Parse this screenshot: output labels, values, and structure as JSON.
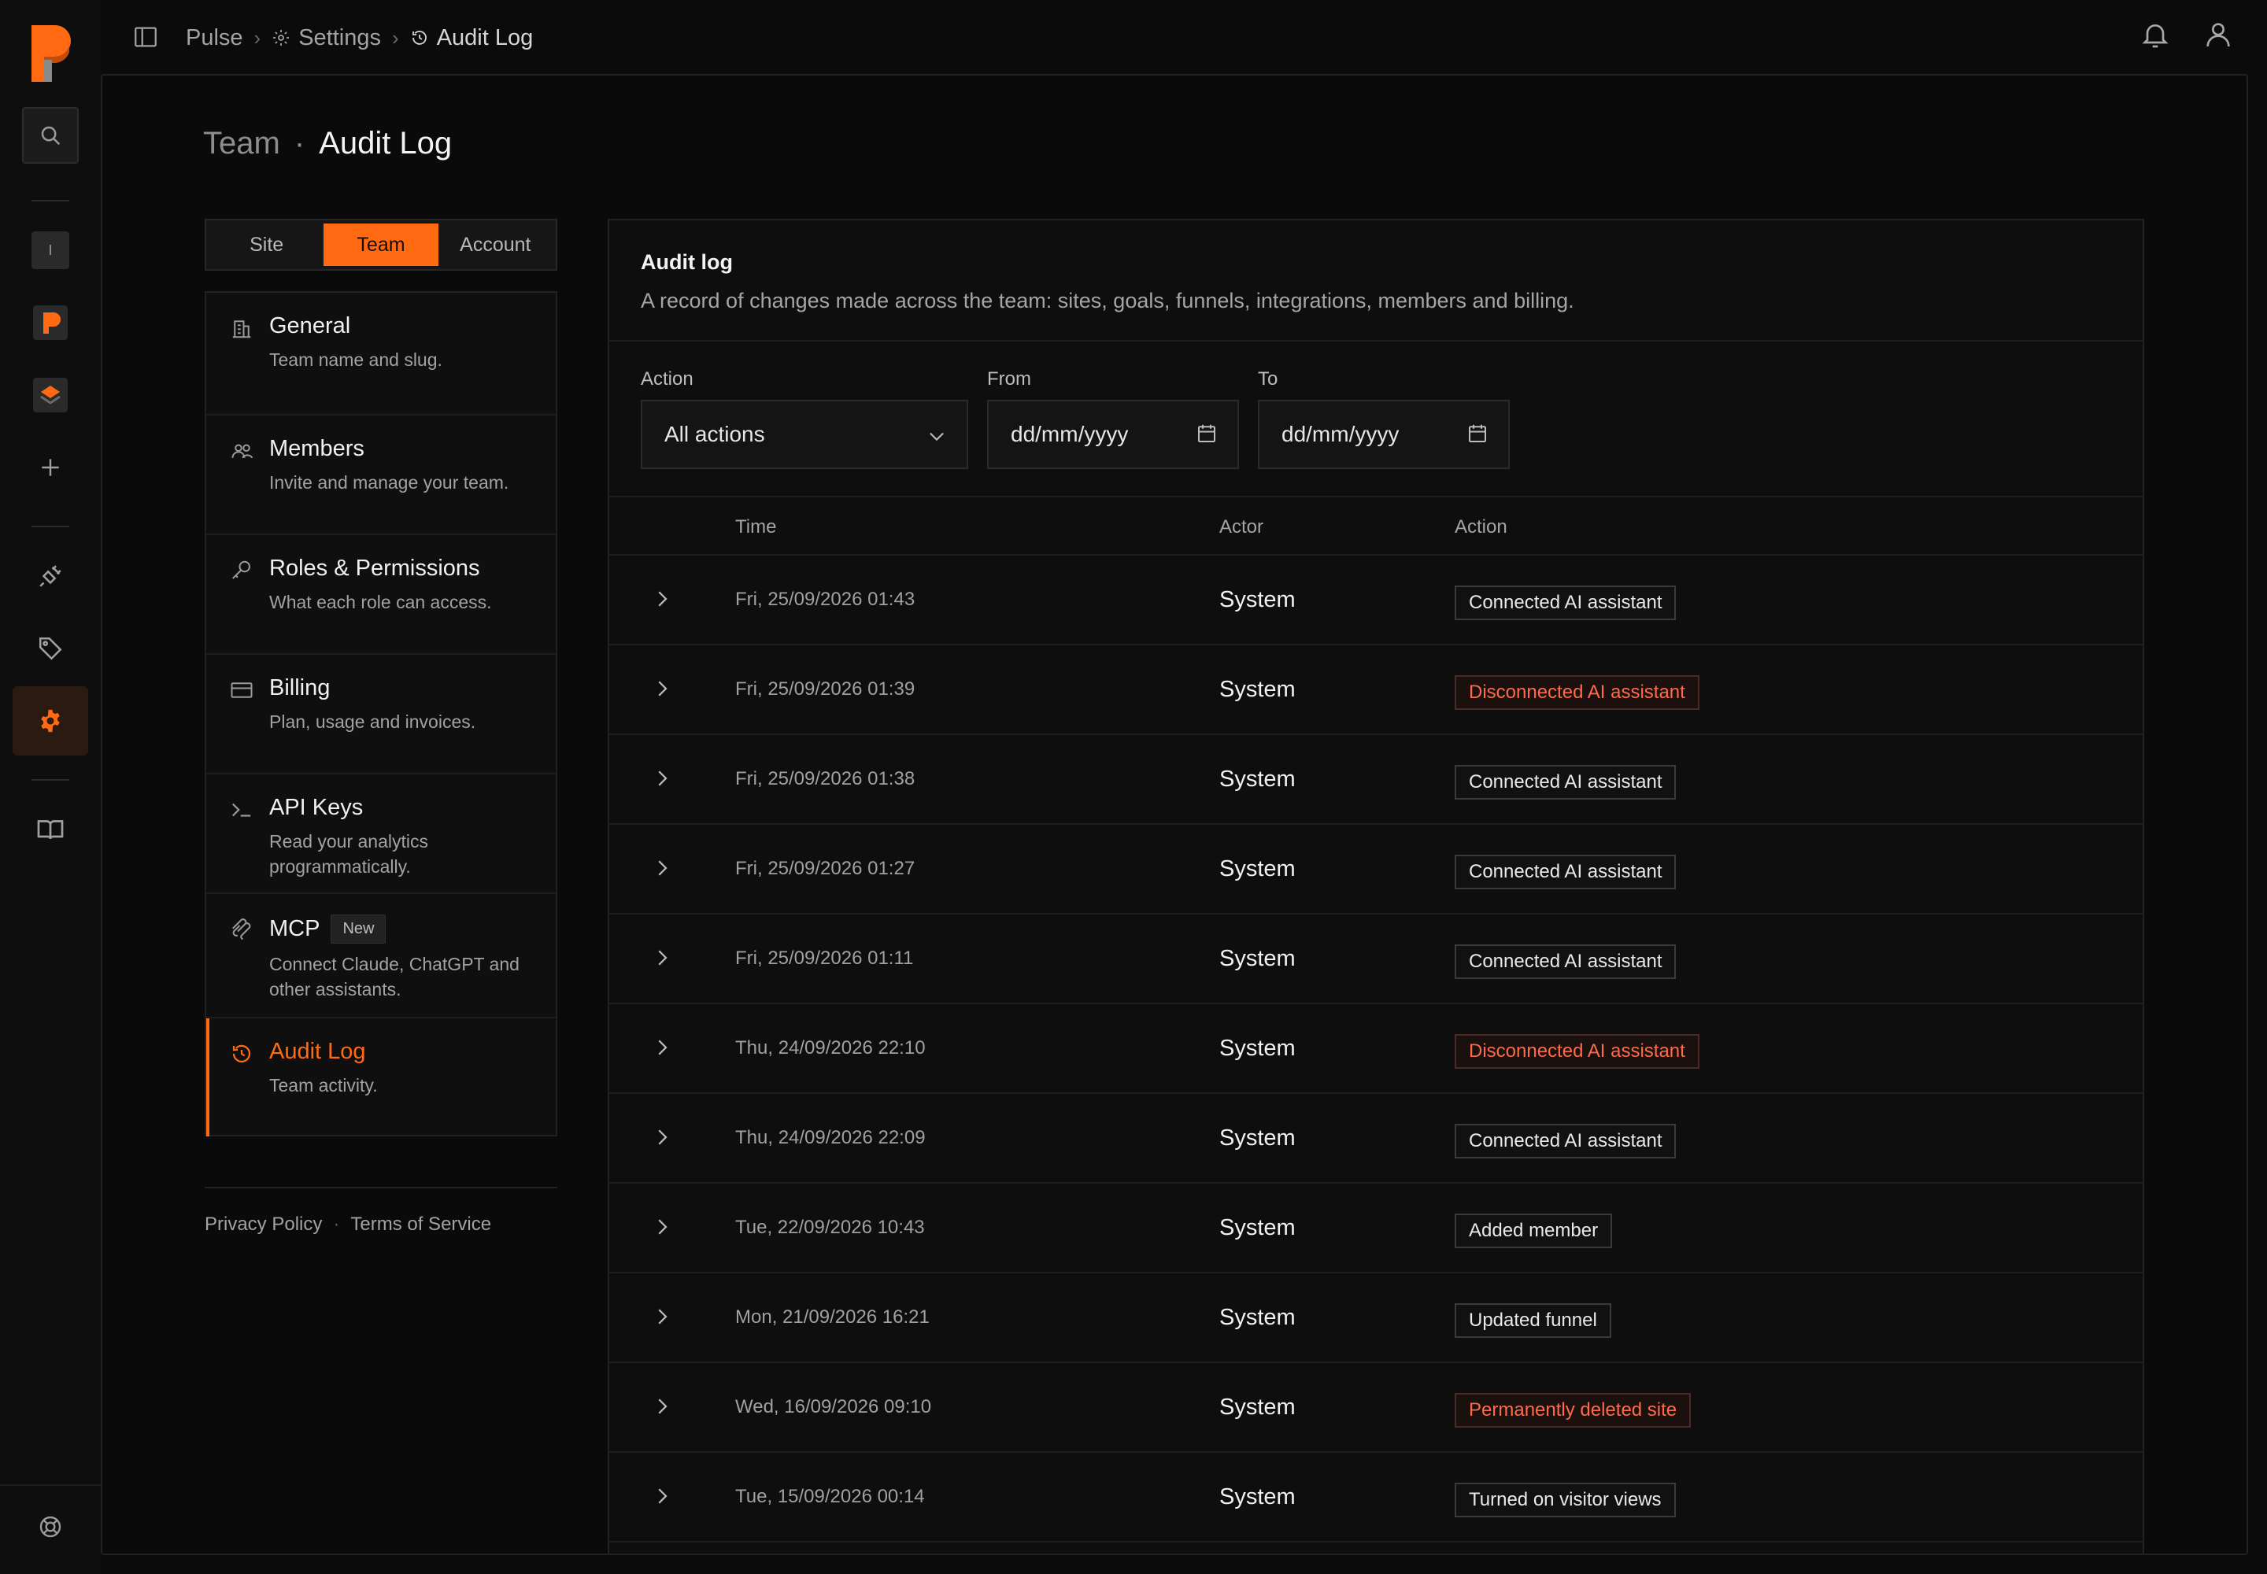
{
  "breadcrumb": {
    "app": "Pulse",
    "section": "Settings",
    "current": "Audit Log"
  },
  "page_title": {
    "scope": "Team",
    "separator": "·",
    "title": "Audit Log"
  },
  "scope_tabs": [
    {
      "label": "Site",
      "active": false
    },
    {
      "label": "Team",
      "active": true
    },
    {
      "label": "Account",
      "active": false
    }
  ],
  "settings_nav": [
    {
      "title": "General",
      "subtitle": "Team name and slug.",
      "icon": "building-icon"
    },
    {
      "title": "Members",
      "subtitle": "Invite and manage your team.",
      "icon": "users-icon"
    },
    {
      "title": "Roles & Permissions",
      "subtitle": "What each role can access.",
      "icon": "key-icon"
    },
    {
      "title": "Billing",
      "subtitle": "Plan, usage and invoices.",
      "icon": "card-icon"
    },
    {
      "title": "API Keys",
      "subtitle": "Read your analytics programmatically.",
      "icon": "terminal-icon"
    },
    {
      "title": "MCP",
      "badge": "New",
      "subtitle": "Connect Claude, ChatGPT and other assistants.",
      "icon": "mcp-icon"
    },
    {
      "title": "Audit Log",
      "subtitle": "Team activity.",
      "icon": "history-icon",
      "active": true
    }
  ],
  "footer": {
    "privacy": "Privacy Policy",
    "separator": "·",
    "terms": "Terms of Service"
  },
  "panel": {
    "title": "Audit log",
    "description": "A record of changes made across the team: sites, goals, funnels, integrations, members and billing."
  },
  "filters": {
    "action_label": "Action",
    "action_value": "All actions",
    "from_label": "From",
    "from_placeholder": "dd/mm/yyyy",
    "to_label": "To",
    "to_placeholder": "dd/mm/yyyy"
  },
  "columns": {
    "time": "Time",
    "actor": "Actor",
    "action": "Action"
  },
  "rows": [
    {
      "time": "Fri, 25/09/2026 01:43",
      "actor": "System",
      "action": "Connected AI assistant",
      "danger": false
    },
    {
      "time": "Fri, 25/09/2026 01:39",
      "actor": "System",
      "action": "Disconnected AI assistant",
      "danger": true
    },
    {
      "time": "Fri, 25/09/2026 01:38",
      "actor": "System",
      "action": "Connected AI assistant",
      "danger": false
    },
    {
      "time": "Fri, 25/09/2026 01:27",
      "actor": "System",
      "action": "Connected AI assistant",
      "danger": false
    },
    {
      "time": "Fri, 25/09/2026 01:11",
      "actor": "System",
      "action": "Connected AI assistant",
      "danger": false
    },
    {
      "time": "Thu, 24/09/2026 22:10",
      "actor": "System",
      "action": "Disconnected AI assistant",
      "danger": true
    },
    {
      "time": "Thu, 24/09/2026 22:09",
      "actor": "System",
      "action": "Connected AI assistant",
      "danger": false
    },
    {
      "time": "Tue, 22/09/2026 10:43",
      "actor": "System",
      "action": "Added member",
      "danger": false
    },
    {
      "time": "Mon, 21/09/2026 16:21",
      "actor": "System",
      "action": "Updated funnel",
      "danger": false
    },
    {
      "time": "Wed, 16/09/2026 09:10",
      "actor": "System",
      "action": "Permanently deleted site",
      "danger": true
    },
    {
      "time": "Tue, 15/09/2026 00:14",
      "actor": "System",
      "action": "Turned on visitor views",
      "danger": false
    }
  ],
  "rail": {
    "site_initial": "I"
  },
  "colors": {
    "accent": "#ff6a13",
    "danger": "#ff6a4a",
    "background": "#0b0b0b"
  }
}
